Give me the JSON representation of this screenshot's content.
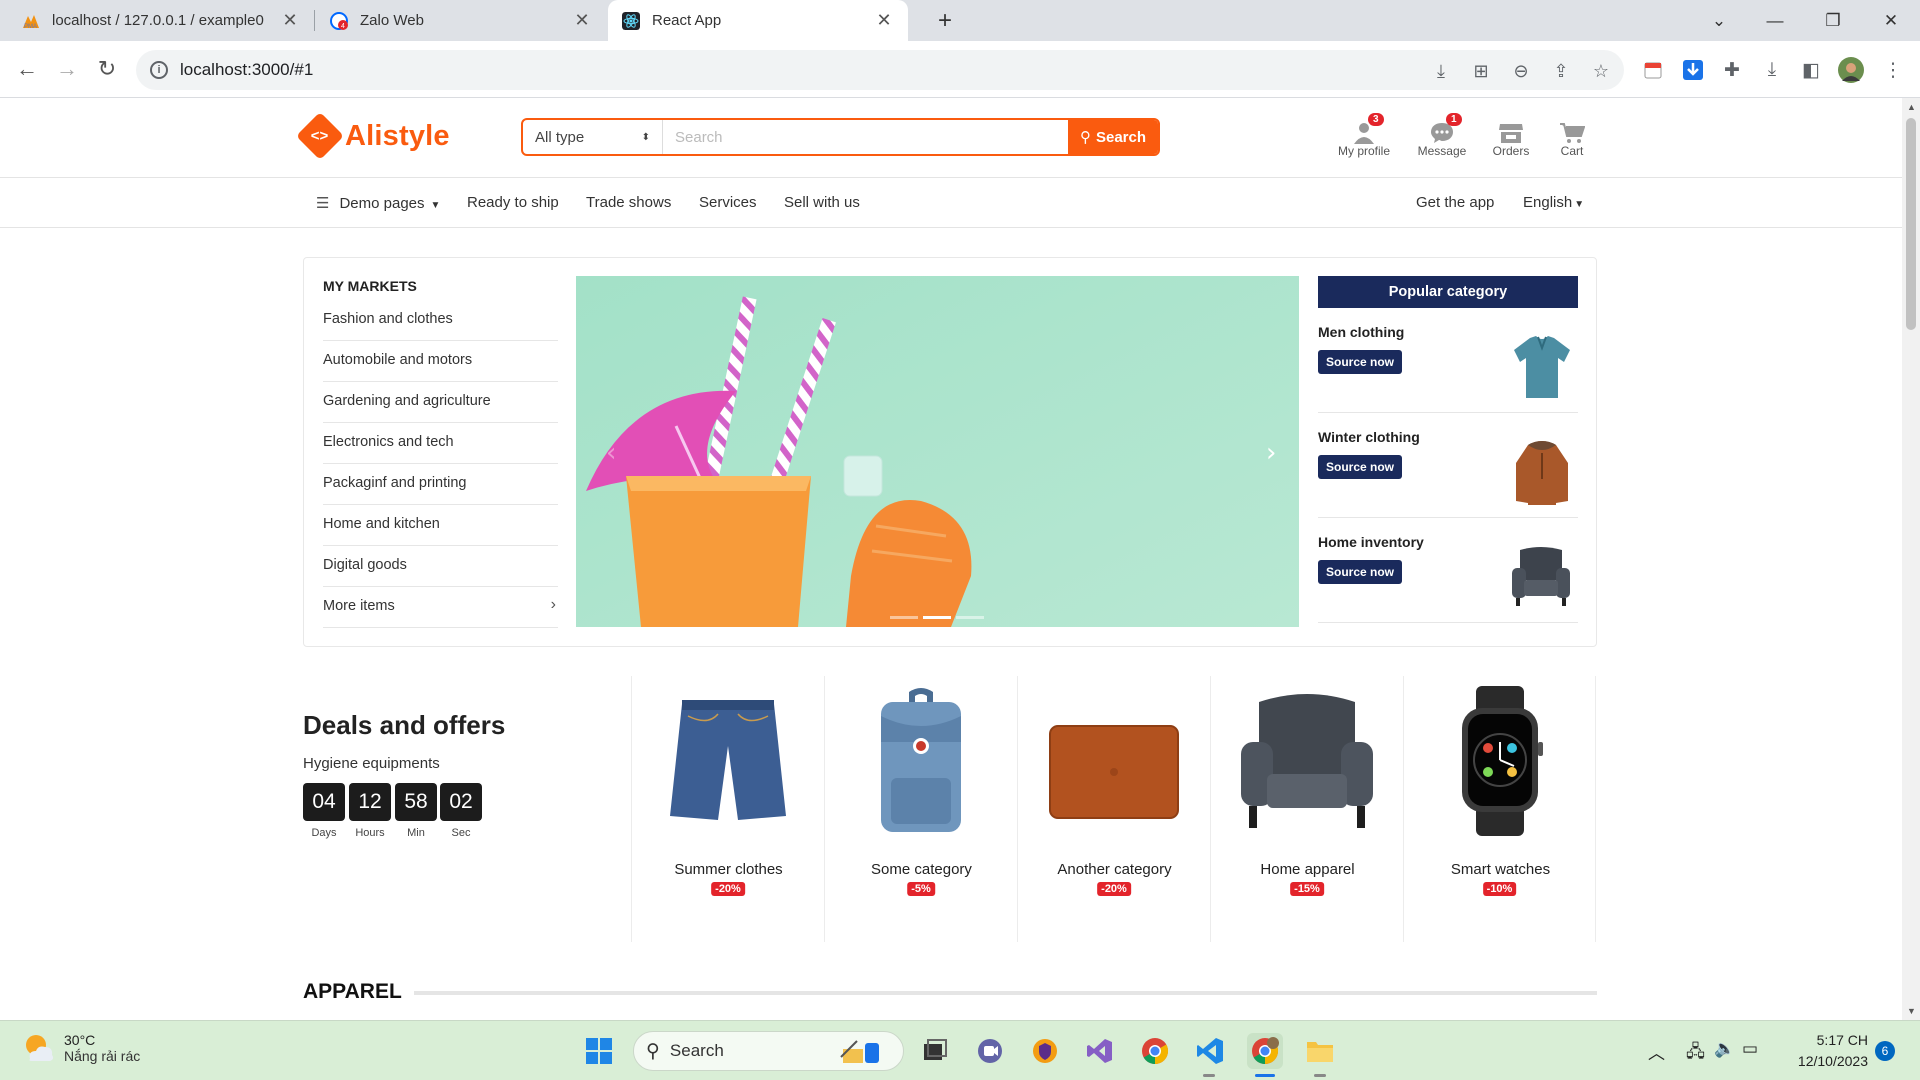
{
  "browser": {
    "tabs": [
      {
        "title": "localhost / 127.0.0.1 / example0",
        "icon": "phpmyadmin-icon"
      },
      {
        "title": "Zalo Web",
        "icon": "zalo-icon"
      },
      {
        "title": "React App",
        "icon": "react-icon"
      }
    ],
    "active_tab": 2,
    "url": "localhost:3000/#1"
  },
  "header": {
    "logo_text": "Alistyle",
    "search": {
      "type_selected": "All type",
      "placeholder": "Search",
      "button_label": "Search"
    },
    "widgets": [
      {
        "label": "My profile",
        "icon": "user-icon",
        "badge": "3"
      },
      {
        "label": "Message",
        "icon": "message-icon",
        "badge": "1"
      },
      {
        "label": "Orders",
        "icon": "store-icon",
        "badge": ""
      },
      {
        "label": "Cart",
        "icon": "cart-icon",
        "badge": ""
      }
    ]
  },
  "nav": {
    "demo_pages": "Demo pages",
    "items": [
      "Ready to ship",
      "Trade shows",
      "Services",
      "Sell with us"
    ],
    "get_app": "Get the app",
    "language": "English"
  },
  "markets": {
    "title": "MY MARKETS",
    "items": [
      "Fashion and clothes",
      "Automobile and motors",
      "Gardening and agriculture",
      "Electronics and tech",
      "Packaginf and printing",
      "Home and kitchen",
      "Digital goods",
      "More items"
    ]
  },
  "banner": {
    "slides": 3,
    "active_slide": 2
  },
  "popular": {
    "title": "Popular category",
    "items": [
      {
        "title": "Men clothing",
        "button": "Source now",
        "icon": "polo-shirt-icon"
      },
      {
        "title": "Winter clothing",
        "button": "Source now",
        "icon": "jacket-icon"
      },
      {
        "title": "Home inventory",
        "button": "Source now",
        "icon": "armchair-icon"
      }
    ]
  },
  "deals": {
    "title": "Deals and offers",
    "subtitle": "Hygiene equipments",
    "timer": [
      {
        "value": "04",
        "label": "Days"
      },
      {
        "value": "12",
        "label": "Hours"
      },
      {
        "value": "58",
        "label": "Min"
      },
      {
        "value": "02",
        "label": "Sec"
      }
    ],
    "items": [
      {
        "name": "Summer clothes",
        "discount": "-20%",
        "icon": "shorts-icon"
      },
      {
        "name": "Some category",
        "discount": "-5%",
        "icon": "backpack-icon"
      },
      {
        "name": "Another category",
        "discount": "-20%",
        "icon": "laptop-sleeve-icon"
      },
      {
        "name": "Home apparel",
        "discount": "-15%",
        "icon": "armchair-icon"
      },
      {
        "name": "Smart watches",
        "discount": "-10%",
        "icon": "smartwatch-icon"
      }
    ]
  },
  "section": {
    "title": "APPAREL"
  },
  "taskbar": {
    "weather_temp": "30°C",
    "weather_desc": "Nắng rải rác",
    "search_label": "Search",
    "time": "5:17 CH",
    "date": "12/10/2023",
    "notifications": "6"
  },
  "colors": {
    "accent": "#fa5b0f",
    "navy": "#1a2a5c",
    "badge": "#e3242b"
  }
}
